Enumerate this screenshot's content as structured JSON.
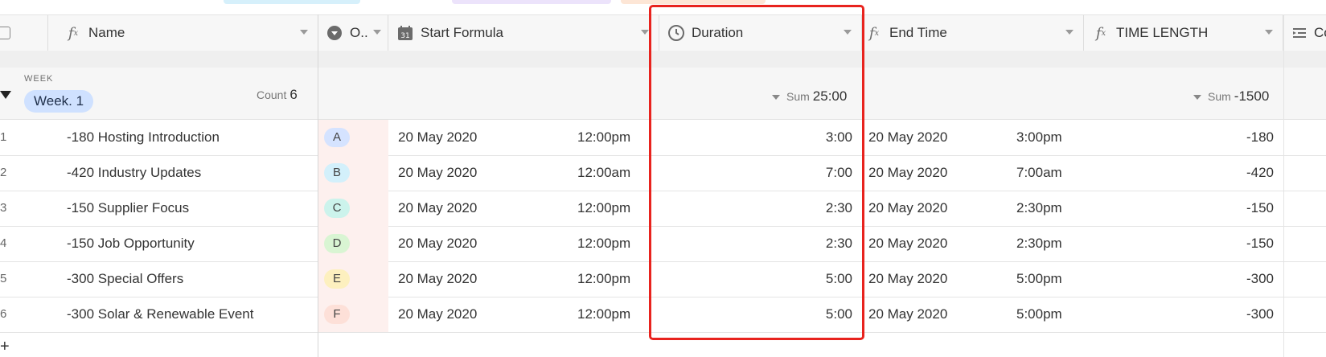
{
  "header": {
    "name": "Name",
    "option": "O..",
    "start_formula": "Start Formula",
    "duration": "Duration",
    "end_time": "End Time",
    "time_length": "TIME LENGTH",
    "next": "Co"
  },
  "icons": {
    "formula": "fx-formula-icon",
    "option": "single-select-icon",
    "calendar": "calendar-icon",
    "duration": "clock-icon",
    "lookup": "list-icon"
  },
  "group": {
    "field": "WEEK",
    "value": "Week. 1",
    "count_label": "Count",
    "count_value": "6",
    "sum_label": "Sum",
    "duration_sum": "25:00",
    "length_sum": "-1500"
  },
  "rows": [
    {
      "num": "1",
      "name": "-180 Hosting Introduction",
      "opt": "A",
      "start_date": "20 May 2020",
      "start_time": "12:00pm",
      "duration": "3:00",
      "end_date": "20 May 2020",
      "end_time": "3:00pm",
      "length": "-180"
    },
    {
      "num": "2",
      "name": "-420 Industry Updates",
      "opt": "B",
      "start_date": "20 May 2020",
      "start_time": "12:00am",
      "duration": "7:00",
      "end_date": "20 May 2020",
      "end_time": "7:00am",
      "length": "-420"
    },
    {
      "num": "3",
      "name": "-150 Supplier Focus",
      "opt": "C",
      "start_date": "20 May 2020",
      "start_time": "12:00pm",
      "duration": "2:30",
      "end_date": "20 May 2020",
      "end_time": "2:30pm",
      "length": "-150"
    },
    {
      "num": "4",
      "name": "-150 Job Opportunity",
      "opt": "D",
      "start_date": "20 May 2020",
      "start_time": "12:00pm",
      "duration": "2:30",
      "end_date": "20 May 2020",
      "end_time": "2:30pm",
      "length": "-150"
    },
    {
      "num": "5",
      "name": "-300 Special Offers",
      "opt": "E",
      "start_date": "20 May 2020",
      "start_time": "12:00pm",
      "duration": "5:00",
      "end_date": "20 May 2020",
      "end_time": "5:00pm",
      "length": "-300"
    },
    {
      "num": "6",
      "name": "-300 Solar & Renewable Event",
      "opt": "F",
      "start_date": "20 May 2020",
      "start_time": "12:00pm",
      "duration": "5:00",
      "end_date": "20 May 2020",
      "end_time": "5:00pm",
      "length": "-300"
    }
  ],
  "badge_colors": [
    "#d5e3ff",
    "#d3f0fb",
    "#ccf3ec",
    "#d9f5d3",
    "#fdf0bf",
    "#fde0d8"
  ],
  "add_row": "+",
  "highlight_color": "#e8231e"
}
